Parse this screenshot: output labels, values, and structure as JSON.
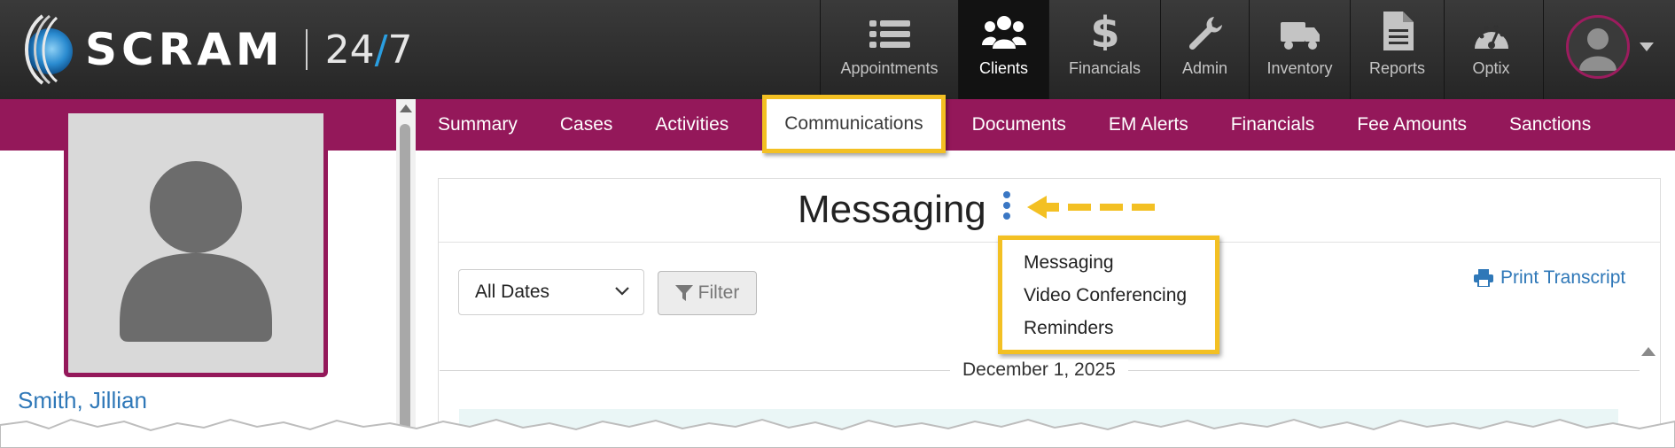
{
  "brand": {
    "name": "SCRAM",
    "suffix_a": "24",
    "suffix_slash": "/",
    "suffix_b": "7"
  },
  "nav": {
    "items": [
      {
        "label": "Appointments",
        "icon": "list-icon"
      },
      {
        "label": "Clients",
        "icon": "users-icon",
        "active": true
      },
      {
        "label": "Financials",
        "icon": "dollar-icon"
      },
      {
        "label": "Admin",
        "icon": "wrench-icon"
      },
      {
        "label": "Inventory",
        "icon": "truck-icon"
      },
      {
        "label": "Reports",
        "icon": "document-icon"
      },
      {
        "label": "Optix",
        "icon": "gauge-icon"
      }
    ]
  },
  "client": {
    "name": "Smith, Jillian"
  },
  "tabs": [
    {
      "label": "Summary"
    },
    {
      "label": "Cases"
    },
    {
      "label": "Activities"
    },
    {
      "label": "Communications",
      "active": true
    },
    {
      "label": "Documents"
    },
    {
      "label": "EM Alerts"
    },
    {
      "label": "Financials"
    },
    {
      "label": "Fee Amounts"
    },
    {
      "label": "Sanctions"
    }
  ],
  "messaging": {
    "title": "Messaging",
    "dropdown": [
      "Messaging",
      "Video Conferencing",
      "Reminders"
    ],
    "date_select": "All Dates",
    "filter_label": "Filter",
    "print_label": "Print Transcript",
    "date_header": "December 1, 2025"
  },
  "colors": {
    "accent": "#94185a",
    "highlight": "#f3c023",
    "link": "#2f78b8"
  }
}
